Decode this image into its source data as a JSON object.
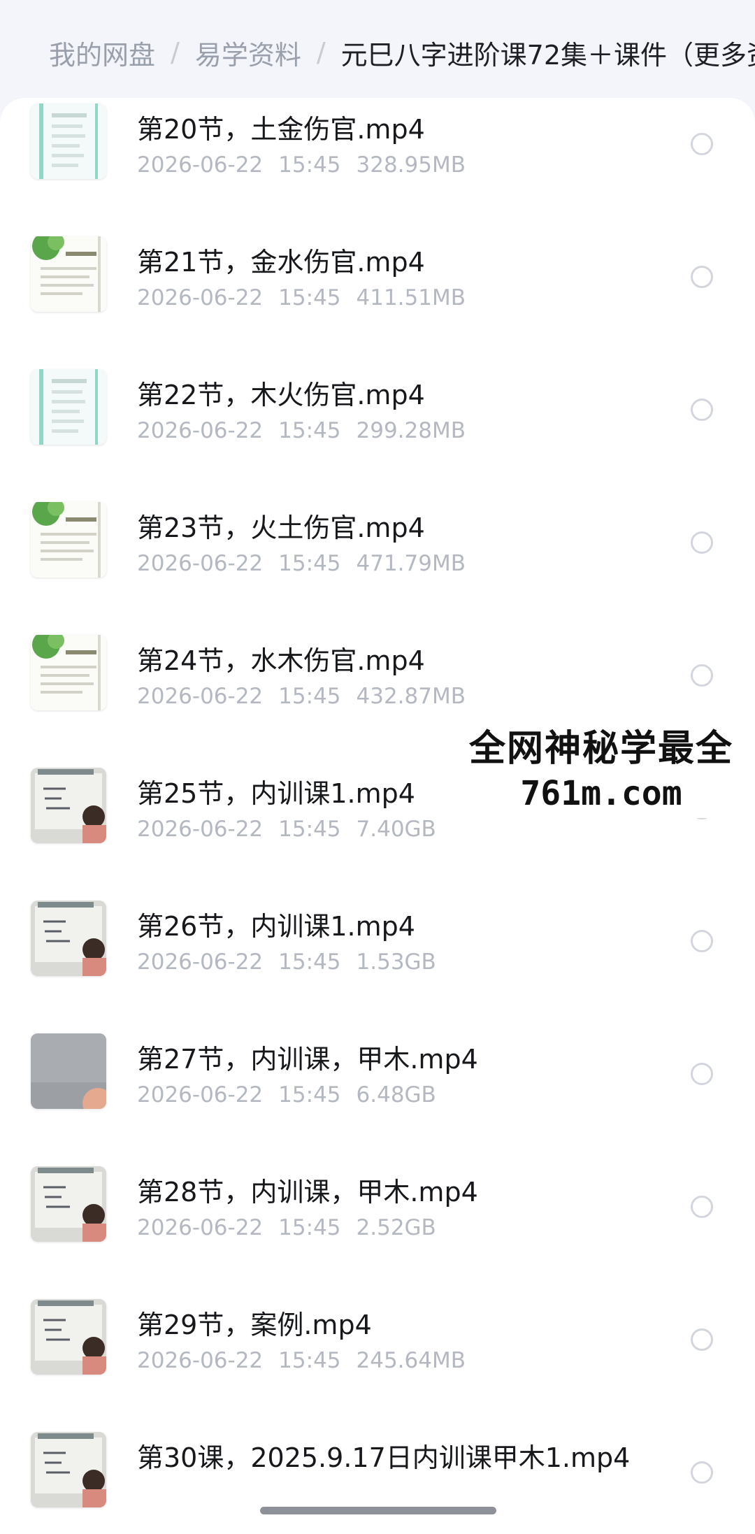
{
  "breadcrumb": {
    "items": [
      "我的网盘",
      "易学资料",
      "元巳八字进阶课72集＋课件（更多资"
    ],
    "separator": "/"
  },
  "files": [
    {
      "name": "第20节，土金伤官.mp4",
      "date": "2026-06-22",
      "time": "15:45",
      "size": "328.95MB",
      "thumb": "slide-icon"
    },
    {
      "name": "第21节，金水伤官.mp4",
      "date": "2026-06-22",
      "time": "15:45",
      "size": "411.51MB",
      "thumb": "lotus-slide-icon"
    },
    {
      "name": "第22节，木火伤官.mp4",
      "date": "2026-06-22",
      "time": "15:45",
      "size": "299.28MB",
      "thumb": "slide-icon"
    },
    {
      "name": "第23节，火土伤官.mp4",
      "date": "2026-06-22",
      "time": "15:45",
      "size": "471.79MB",
      "thumb": "lotus-slide-icon"
    },
    {
      "name": "第24节，水木伤官.mp4",
      "date": "2026-06-22",
      "time": "15:45",
      "size": "432.87MB",
      "thumb": "lotus-slide-icon"
    },
    {
      "name": "第25节，内训课1.mp4",
      "date": "2026-06-22",
      "time": "15:45",
      "size": "7.40GB",
      "thumb": "whiteboard-video-icon"
    },
    {
      "name": "第26节，内训课1.mp4",
      "date": "2026-06-22",
      "time": "15:45",
      "size": "1.53GB",
      "thumb": "whiteboard-video-icon"
    },
    {
      "name": "第27节，内训课，甲木.mp4",
      "date": "2026-06-22",
      "time": "15:45",
      "size": "6.48GB",
      "thumb": "gray-video-icon"
    },
    {
      "name": "第28节，内训课，甲木.mp4",
      "date": "2026-06-22",
      "time": "15:45",
      "size": "2.52GB",
      "thumb": "whiteboard-video-icon"
    },
    {
      "name": "第29节，案例.mp4",
      "date": "2026-06-22",
      "time": "15:45",
      "size": "245.64MB",
      "thumb": "whiteboard-video-icon"
    },
    {
      "name": "第30课，2025.9.17日内训课甲木1.mp4",
      "date": "",
      "time": "",
      "size": "",
      "thumb": "whiteboard-video-icon"
    }
  ],
  "watermark": {
    "line1": "全网神秘学最全",
    "line2": "761m.com"
  },
  "colors": {
    "accent_slide": "#7fd3c2",
    "lotus_green": "#5aa64a",
    "meta_text": "#b4b8c0"
  }
}
